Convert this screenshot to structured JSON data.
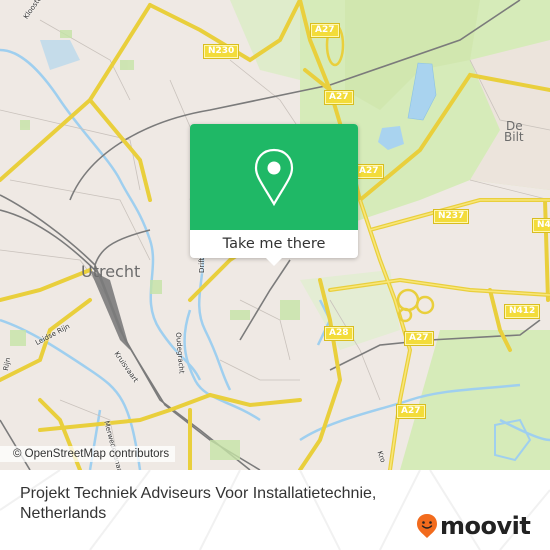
{
  "map": {
    "place_labels": {
      "utrecht": "Utrecht",
      "de_bilt_1": "De",
      "de_bilt_2": "Bilt"
    },
    "road_shields": [
      {
        "id": "n230",
        "label": "N230"
      },
      {
        "id": "a27-top",
        "label": "A27"
      },
      {
        "id": "a27-upper",
        "label": "A27"
      },
      {
        "id": "a27-mid",
        "label": "A27"
      },
      {
        "id": "n237",
        "label": "N237"
      },
      {
        "id": "n4-edge",
        "label": "N4"
      },
      {
        "id": "n412",
        "label": "N412"
      },
      {
        "id": "a28",
        "label": "A28"
      },
      {
        "id": "a27-lower",
        "label": "A27"
      },
      {
        "id": "a27-bottom",
        "label": "A27"
      }
    ],
    "street_labels": {
      "kloosterlaan": "Kloosterla",
      "leidse_rijn": "Leidse Rijn",
      "kruisvaart": "Kruisvaart",
      "drift": "Drift",
      "oudegracht": "Oudegracht",
      "merwedekanaal": "Merwedekanaal",
      "rijn": "Rijn",
      "kromme": "Kro"
    },
    "attribution": "© OpenStreetMap contributors"
  },
  "popup": {
    "icon": "map-pin-icon",
    "cta_label": "Take me there",
    "accent_color": "#1fb866"
  },
  "footer": {
    "place_name": "Projekt Techniek Adviseurs Voor Installatietechnie, Netherlands",
    "brand": "moovit",
    "brand_color": "#f26b1d"
  }
}
